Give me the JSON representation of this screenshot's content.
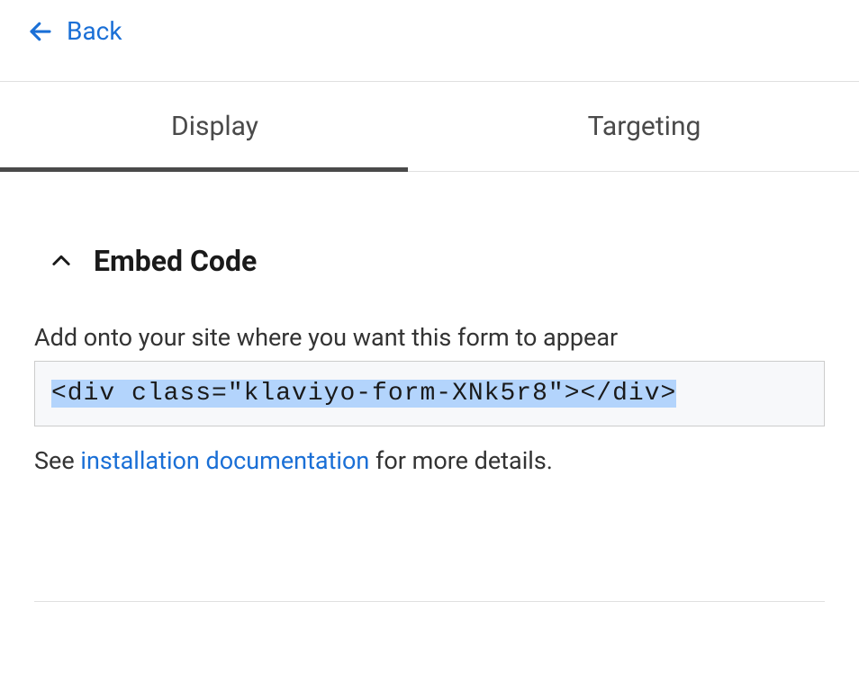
{
  "header": {
    "back_label": "Back"
  },
  "tabs": {
    "display_label": "Display",
    "targeting_label": "Targeting"
  },
  "embed": {
    "section_title": "Embed Code",
    "instruction": "Add onto your site where you want this form to appear",
    "code": "<div class=\"klaviyo-form-XNk5r8\"></div>",
    "help_text_prefix": "See ",
    "help_link_label": "installation documentation",
    "help_text_suffix": " for more details."
  }
}
